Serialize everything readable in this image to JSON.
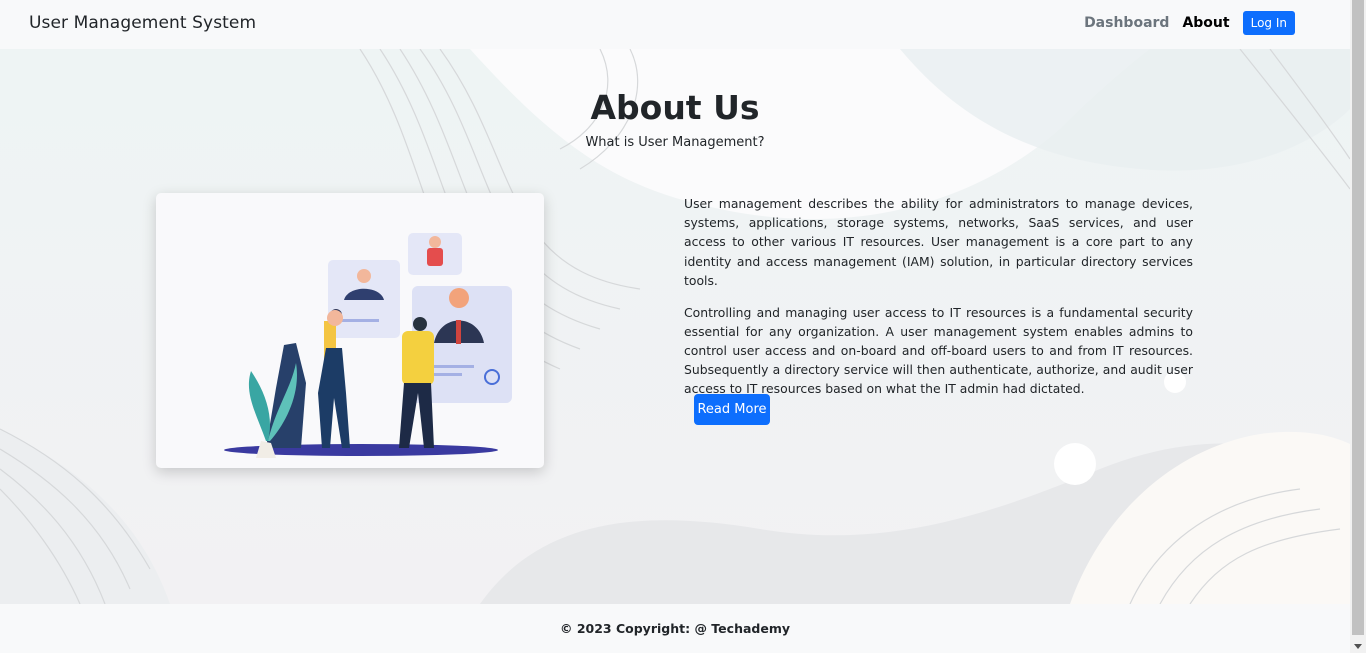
{
  "navbar": {
    "brand": "User Management System",
    "links": [
      {
        "label": "Dashboard",
        "active": false
      },
      {
        "label": "About",
        "active": true
      }
    ],
    "login_label": "Log In"
  },
  "main": {
    "title": "About Us",
    "subtitle": "What is User Management?",
    "paragraphs": [
      "User management describes the ability for administrators to manage devices, systems, applications, storage systems, networks, SaaS services, and user access to other various IT resources. User management is a core part to any identity and access management (IAM) solution, in particular directory services tools.",
      "Controlling and managing user access to IT resources is a fundamental security essential for any organization. A user management system enables admins to control user access and on-board and off-board users to and from IT resources. Subsequently a directory service will then authenticate, authorize, and audit user access to IT resources based on what the IT admin had dictated."
    ],
    "read_more_label": "Read More",
    "illustration": "user-management-illustration"
  },
  "footer": {
    "copyright": "© 2023 Copyright: @ Techademy"
  },
  "colors": {
    "primary": "#0d6efd",
    "navbar_bg": "#f8f9fa",
    "text": "#212529",
    "muted": "#6c757d"
  }
}
